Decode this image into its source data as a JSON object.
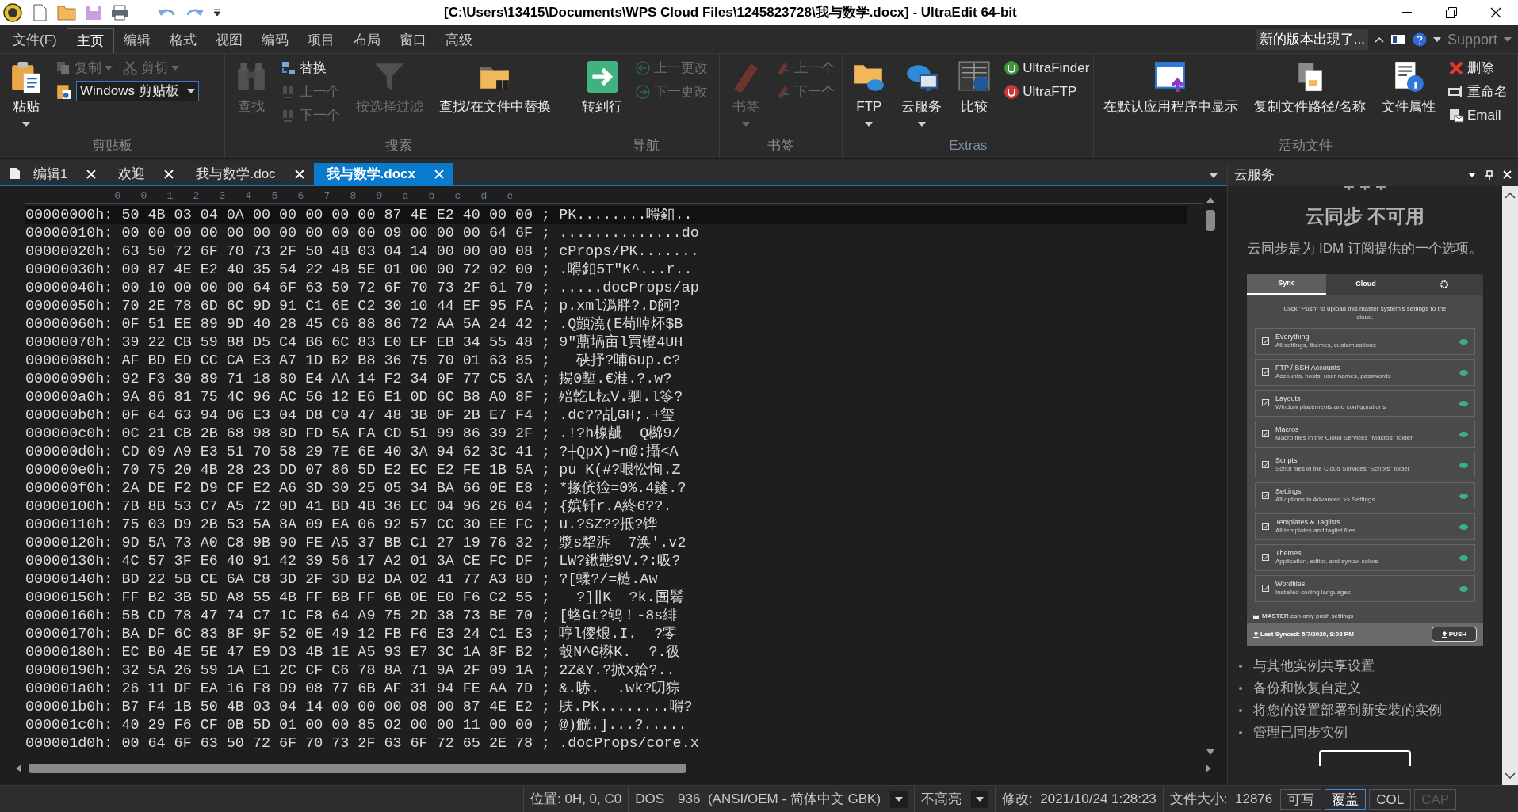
{
  "window": {
    "title": "[C:\\Users\\13415\\Documents\\WPS Cloud Files\\1245823728\\我与数学.docx] - UltraEdit 64-bit"
  },
  "menu_tabs": [
    {
      "label": "文件(F)",
      "selected": false
    },
    {
      "label": "主页",
      "selected": true
    },
    {
      "label": "编辑",
      "selected": false
    },
    {
      "label": "格式",
      "selected": false
    },
    {
      "label": "视图",
      "selected": false
    },
    {
      "label": "编码",
      "selected": false
    },
    {
      "label": "项目",
      "selected": false
    },
    {
      "label": "布局",
      "selected": false
    },
    {
      "label": "窗口",
      "selected": false
    },
    {
      "label": "高级",
      "selected": false
    }
  ],
  "update_notice": "新的版本出現了...",
  "support": "Support",
  "ribbon_groups": [
    {
      "title": "剪贴板",
      "columns": [
        [
          [
            {
              "label": "粘贴",
              "kind": "large",
              "disabled": false,
              "caret": true
            }
          ]
        ],
        [
          [
            {
              "label": "复制",
              "kind": "small",
              "disabled": true,
              "caret": true
            },
            {
              "label": "剪切",
              "kind": "small",
              "disabled": true,
              "caret": true
            }
          ],
          [
            {
              "kind": "dropdown",
              "value": "Windows 剪贴板"
            }
          ]
        ]
      ]
    },
    {
      "title": "搜索",
      "columns": [
        [
          [
            {
              "label": "查找",
              "kind": "large",
              "disabled": true,
              "caret": false
            }
          ]
        ],
        [
          [
            {
              "label": "替换",
              "kind": "small",
              "disabled": false,
              "caret": false
            }
          ],
          [
            {
              "label": "上一个",
              "kind": "small",
              "disabled": true,
              "caret": false
            }
          ],
          [
            {
              "label": "下一个",
              "kind": "small",
              "disabled": true,
              "caret": false
            }
          ]
        ],
        [
          [
            {
              "label": "按选择过滤",
              "kind": "large",
              "disabled": true,
              "caret": false
            }
          ]
        ],
        [
          [
            {
              "label": "查找/在文件中替换",
              "kind": "large",
              "disabled": false,
              "caret": false
            }
          ]
        ]
      ]
    },
    {
      "title": "导航",
      "columns": [
        [
          [
            {
              "label": "转到行",
              "kind": "large",
              "disabled": false,
              "caret": false
            }
          ]
        ],
        [
          [
            {
              "label": "上一更改",
              "kind": "small",
              "disabled": true,
              "caret": false
            }
          ],
          [
            {
              "label": "下一更改",
              "kind": "small",
              "disabled": true,
              "caret": false
            }
          ]
        ]
      ]
    },
    {
      "title": "书签",
      "columns": [
        [
          [
            {
              "label": "书签",
              "kind": "large",
              "disabled": true,
              "caret": true
            }
          ]
        ],
        [
          [
            {
              "label": "上一个",
              "kind": "small",
              "disabled": true,
              "caret": false
            }
          ],
          [
            {
              "label": "下一个",
              "kind": "small",
              "disabled": true,
              "caret": false
            }
          ]
        ]
      ]
    },
    {
      "title": "Extras",
      "columns": [
        [
          [
            {
              "label": "FTP",
              "kind": "large",
              "disabled": false,
              "caret": true
            }
          ]
        ],
        [
          [
            {
              "label": "云服务",
              "kind": "large",
              "disabled": false,
              "caret": true
            }
          ]
        ],
        [
          [
            {
              "label": "比较",
              "kind": "large",
              "disabled": false,
              "caret": false
            }
          ]
        ],
        [
          [
            {
              "label": "UltraFinder",
              "kind": "small",
              "disabled": false,
              "caret": false
            }
          ],
          [
            {
              "label": "UltraFTP",
              "kind": "small",
              "disabled": false,
              "caret": false
            }
          ]
        ]
      ]
    },
    {
      "title": "活动文件",
      "columns": [
        [
          [
            {
              "label": "在默认应用程序中显示",
              "kind": "large",
              "disabled": false,
              "caret": false
            }
          ]
        ],
        [
          [
            {
              "label": "复制文件路径/名称",
              "kind": "large",
              "disabled": false,
              "caret": false
            }
          ]
        ],
        [
          [
            {
              "label": "文件属性",
              "kind": "large",
              "disabled": false,
              "caret": false
            }
          ]
        ],
        [
          [
            {
              "label": "删除",
              "kind": "small",
              "disabled": false,
              "caret": false
            }
          ],
          [
            {
              "label": "重命名",
              "kind": "small",
              "disabled": false,
              "caret": false
            }
          ],
          [
            {
              "label": "Email",
              "kind": "small",
              "disabled": false,
              "caret": false
            }
          ]
        ]
      ]
    }
  ],
  "doc_tabs": [
    {
      "label": "编辑1",
      "selected": false
    },
    {
      "label": "欢迎",
      "selected": false
    },
    {
      "label": "我与数学.doc",
      "selected": false
    },
    {
      "label": "我与数学.docx",
      "selected": true
    }
  ],
  "ruler": [
    "0",
    "0",
    "1",
    "2",
    "3",
    "4",
    "5",
    "6",
    "7",
    "8",
    "9",
    "a",
    "b",
    "c",
    "d",
    "e"
  ],
  "rows": [
    {
      "offset": "00000000h:",
      "hex": "50 4B 03 04 0A 00 00 00 00 00 87 4E E2 40 00 00",
      "sep": ";",
      "ascii": "PK........嘚釦..",
      "current": true
    },
    {
      "offset": "00000010h:",
      "hex": "00 00 00 00 00 00 00 00 00 00 09 00 00 00 64 6F",
      "sep": ";",
      "ascii": "..............do",
      "current": false
    },
    {
      "offset": "00000020h:",
      "hex": "63 50 72 6F 70 73 2F 50 4B 03 04 14 00 00 00 08",
      "sep": ";",
      "ascii": "cProps/PK.......",
      "current": false
    },
    {
      "offset": "00000030h:",
      "hex": "00 87 4E E2 40 35 54 22 4B 5E 01 00 00 72 02 00",
      "sep": ";",
      "ascii": ".嘚釦5T\"K^...r..",
      "current": false
    },
    {
      "offset": "00000040h:",
      "hex": "00 10 00 00 00 64 6F 63 50 72 6F 70 73 2F 61 70",
      "sep": ";",
      "ascii": ".....docProps/ap",
      "current": false
    },
    {
      "offset": "00000050h:",
      "hex": "70 2E 78 6D 6C 9D 91 C1 6E C2 30 10 44 EF 95 FA",
      "sep": ";",
      "ascii": "p.xml潙胖?.D飼?",
      "current": false
    },
    {
      "offset": "00000060h:",
      "hex": "0F 51 EE 89 9D 40 28 45 C6 88 86 72 AA 5A 24 42",
      "sep": ";",
      "ascii": ".Q顗澆(E苟啅炋$B",
      "current": false
    },
    {
      "offset": "00000070h:",
      "hex": "39 22 CB 59 88 D5 C4 B6 6C 83 E0 EF EB 34 55 48",
      "sep": ";",
      "ascii": "9\"薡堝亩l買镫4UH",
      "current": false
    },
    {
      "offset": "00000080h:",
      "hex": "AF BD ED CC CA E3 A7 1D B2 B8 36 75 70 01 63 85",
      "sep": ";",
      "ascii": "  硖抒?哺6up.c?",
      "current": false
    },
    {
      "offset": "00000090h:",
      "hex": "92 F3 30 89 71 18 80 E4 AA 14 F2 34 0F 77 C5 3A",
      "sep": ";",
      "ascii": "掦0塹.€溎.?.w?",
      "current": false
    },
    {
      "offset": "000000a0h:",
      "hex": "9A 86 81 75 4C 96 AC 56 12 E6 E1 0D 6C B8 A0 8F",
      "sep": ";",
      "ascii": "殕亁L枟V.驷.l笭?",
      "current": false
    },
    {
      "offset": "000000b0h:",
      "hex": "0F 64 63 94 06 E3 04 D8 C0 47 48 3B 0F 2B E7 F4",
      "sep": ";",
      "ascii": ".dc??乩GH;.+玺",
      "current": false
    },
    {
      "offset": "000000c0h:",
      "hex": "0C 21 CB 2B 68 98 8D FD 5A FA CD 51 99 86 39 2F",
      "sep": ";",
      "ascii": ".!?h楾龇  Q檰9/",
      "current": false
    },
    {
      "offset": "000000d0h:",
      "hex": "CD 09 A9 E3 51 70 58 29 7E 6E 40 3A 94 62 3C 41",
      "sep": ";",
      "ascii": "?┼QpX)~n@:攝<A",
      "current": false
    },
    {
      "offset": "000000e0h:",
      "hex": "70 75 20 4B 28 23 DD 07 86 5D E2 EC E2 FE 1B 5A",
      "sep": ";",
      "ascii": "pu K(#?哏忪恂.Z",
      "current": false
    },
    {
      "offset": "000000f0h:",
      "hex": "2A DE F2 D9 CF E2 A6 3D 30 25 05 34 BA 66 0E E8",
      "sep": ";",
      "ascii": "*掾傧猃=0%.4鏟.?",
      "current": false
    },
    {
      "offset": "00000100h:",
      "hex": "7B 8B 53 C7 A5 72 0D 41 BD 4B 36 EC 04 96 26 04",
      "sep": ";",
      "ascii": "{嫔钎r.A終6??.",
      "current": false
    },
    {
      "offset": "00000110h:",
      "hex": "75 03 D9 2B 53 5A 8A 09 EA 06 92 57 CC 30 EE FC",
      "sep": ";",
      "ascii": "u.?SZ??抵?铧",
      "current": false
    },
    {
      "offset": "00000120h:",
      "hex": "9D 5A 73 A0 C8 9B 90 FE A5 37 BB C1 27 19 76 32",
      "sep": ";",
      "ascii": "漿s犂泝  7涣'.v2",
      "current": false
    },
    {
      "offset": "00000130h:",
      "hex": "4C 57 3F E6 40 91 42 39 56 17 A2 01 3A CE FC DF",
      "sep": ";",
      "ascii": "LW?鍬態9V.?:吸?",
      "current": false
    },
    {
      "offset": "00000140h:",
      "hex": "BD 22 5B CE 6A C8 3D 2F 3D B2 DA 02 41 77 A3 8D",
      "sep": ";",
      "ascii": "?[蝚?/=糙.Aw",
      "current": false
    },
    {
      "offset": "00000150h:",
      "hex": "FF B2 3B 5D A8 55 4B FF BB FF 6B 0E E0 F6 C2 55",
      "sep": ";",
      "ascii": "  ?]‖K  ?k.圄鬌",
      "current": false
    },
    {
      "offset": "00000160h:",
      "hex": "5B CD 78 47 74 C7 1C F8 64 A9 75 2D 38 73 BE 70",
      "sep": ";",
      "ascii": "[蛒Gt?鸲！-8s緋",
      "current": false
    },
    {
      "offset": "00000170h:",
      "hex": "BA DF 6C 83 8F 9F 52 0E 49 12 FB F6 E3 24 C1 E3",
      "sep": ";",
      "ascii": "哼l儍烺.I.  ?零",
      "current": false
    },
    {
      "offset": "00000180h:",
      "hex": "EC B0 4E 5E 47 E9 D3 4B 1E A5 93 E7 3C 1A 8F B2",
      "sep": ";",
      "ascii": "彀N^G楙K.  ?.彶",
      "current": false
    },
    {
      "offset": "00000190h:",
      "hex": "32 5A 26 59 1A E1 2C CF C6 78 8A 71 9A 2F 09 1A",
      "sep": ";",
      "ascii": "2Z&Y.?掀x姶?..",
      "current": false
    },
    {
      "offset": "000001a0h:",
      "hex": "26 11 DF EA 16 F8 D9 08 77 6B AF 31 94 FE AA 7D",
      "sep": ";",
      "ascii": "&.哧.  .wk?叨猔",
      "current": false
    },
    {
      "offset": "000001b0h:",
      "hex": "B7 F4 1B 50 4B 03 04 14 00 00 00 08 00 87 4E E2",
      "sep": ";",
      "ascii": "肤.PK........嘚?",
      "current": false
    },
    {
      "offset": "000001c0h:",
      "hex": "40 29 F6 CF 0B 5D 01 00 00 85 02 00 00 11 00 00",
      "sep": ";",
      "ascii": "@)觥.]...?.....",
      "current": false
    },
    {
      "offset": "000001d0h:",
      "hex": "00 64 6F 63 50 72 6F 70 73 2F 63 6F 72 65 2E 78",
      "sep": ";",
      "ascii": ".docProps/core.x",
      "current": false
    }
  ],
  "cloud_panel": {
    "title": "云服务",
    "heading": "云同步 不可用",
    "description": "云同步是为 IDM 订阅提供的一个选项。",
    "preview": {
      "tabs": [
        {
          "label": "Sync",
          "selected": true
        },
        {
          "label": "Cloud",
          "selected": false
        }
      ],
      "message": "Click \"Push\" to upload this master system's settings to the cloud.",
      "items": [
        {
          "title": "Everything",
          "subtitle": "All settings, themes, customizations",
          "checked": true
        },
        {
          "title": "FTP / SSH Accounts",
          "subtitle": "Accounts, hosts, user names, passwords",
          "checked": true
        },
        {
          "title": "Layouts",
          "subtitle": "Window placements and configurations",
          "checked": true
        },
        {
          "title": "Macros",
          "subtitle": "Macro files in the Cloud Services \"Macros\" folder",
          "checked": true
        },
        {
          "title": "Scripts",
          "subtitle": "Script files in the Cloud Services \"Scripts\" folder",
          "checked": true
        },
        {
          "title": "Settings",
          "subtitle": "All options in Advanced >> Settings",
          "checked": true
        },
        {
          "title": "Templates & Taglists",
          "subtitle": "All templates and taglist files",
          "checked": true
        },
        {
          "title": "Themes",
          "subtitle": "Application, editor, and syntax colors",
          "checked": true
        },
        {
          "title": "Wordfiles",
          "subtitle": "Installed coding languages",
          "checked": true
        }
      ],
      "master_note": "**MASTER** can only push settings",
      "last_synced": "Last Synced: 5/7/2020, 8:08 PM",
      "push_button": "PUSH"
    },
    "bullets": [
      "与其他实例共享设置",
      "备份和恢复自定义",
      "将您的设置部署到新安装的实例",
      "管理已同步实例"
    ]
  },
  "status_fields": [
    {
      "text": "位置: 0H, 0, C0",
      "kind": "text"
    },
    {
      "text": "DOS",
      "kind": "text"
    },
    {
      "text": "936  (ANSI/OEM - 简体中文 GBK)",
      "kind": "dropdown"
    },
    {
      "text": "不高亮",
      "kind": "dropdown"
    },
    {
      "text": "修改:  2021/10/24 1:28:23",
      "kind": "text"
    },
    {
      "text": "文件大小:  12876",
      "kind": "text"
    }
  ],
  "status_toggles": [
    {
      "text": "可写",
      "selected": false,
      "disabled": false
    },
    {
      "text": "覆盖",
      "selected": true,
      "disabled": false
    },
    {
      "text": "COL",
      "selected": false,
      "disabled": false
    },
    {
      "text": "CAP",
      "selected": false,
      "disabled": true
    }
  ]
}
